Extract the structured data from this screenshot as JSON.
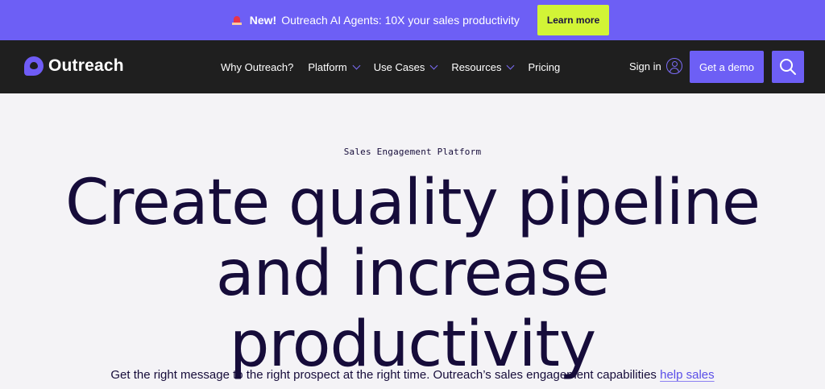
{
  "announcement": {
    "new_label": "New!",
    "text": "Outreach AI Agents: 10X your sales productivity",
    "cta": "Learn more"
  },
  "nav": {
    "logo": "Outreach",
    "items": [
      {
        "label": "Why Outreach?",
        "dropdown": false
      },
      {
        "label": "Platform",
        "dropdown": true
      },
      {
        "label": "Use Cases",
        "dropdown": true
      },
      {
        "label": "Resources",
        "dropdown": true
      },
      {
        "label": "Pricing",
        "dropdown": false
      }
    ],
    "signin": "Sign in",
    "demo": "Get a demo",
    "search_icon": "search-icon"
  },
  "hero": {
    "eyebrow": "Sales Engagement Platform",
    "headline": [
      "Create quality pipeline",
      "and increase",
      "productivity"
    ],
    "lead_text": "Get the right message to the right prospect at the right time. Outreach’s sales engagement capabilities",
    "lead_link": "help sales"
  },
  "colors": {
    "accent": "#6d5ff5",
    "cta": "#d2f436",
    "nav_bg": "#1f1f1f",
    "hero_bg": "#f4f3f6",
    "text": "#160c3a"
  }
}
